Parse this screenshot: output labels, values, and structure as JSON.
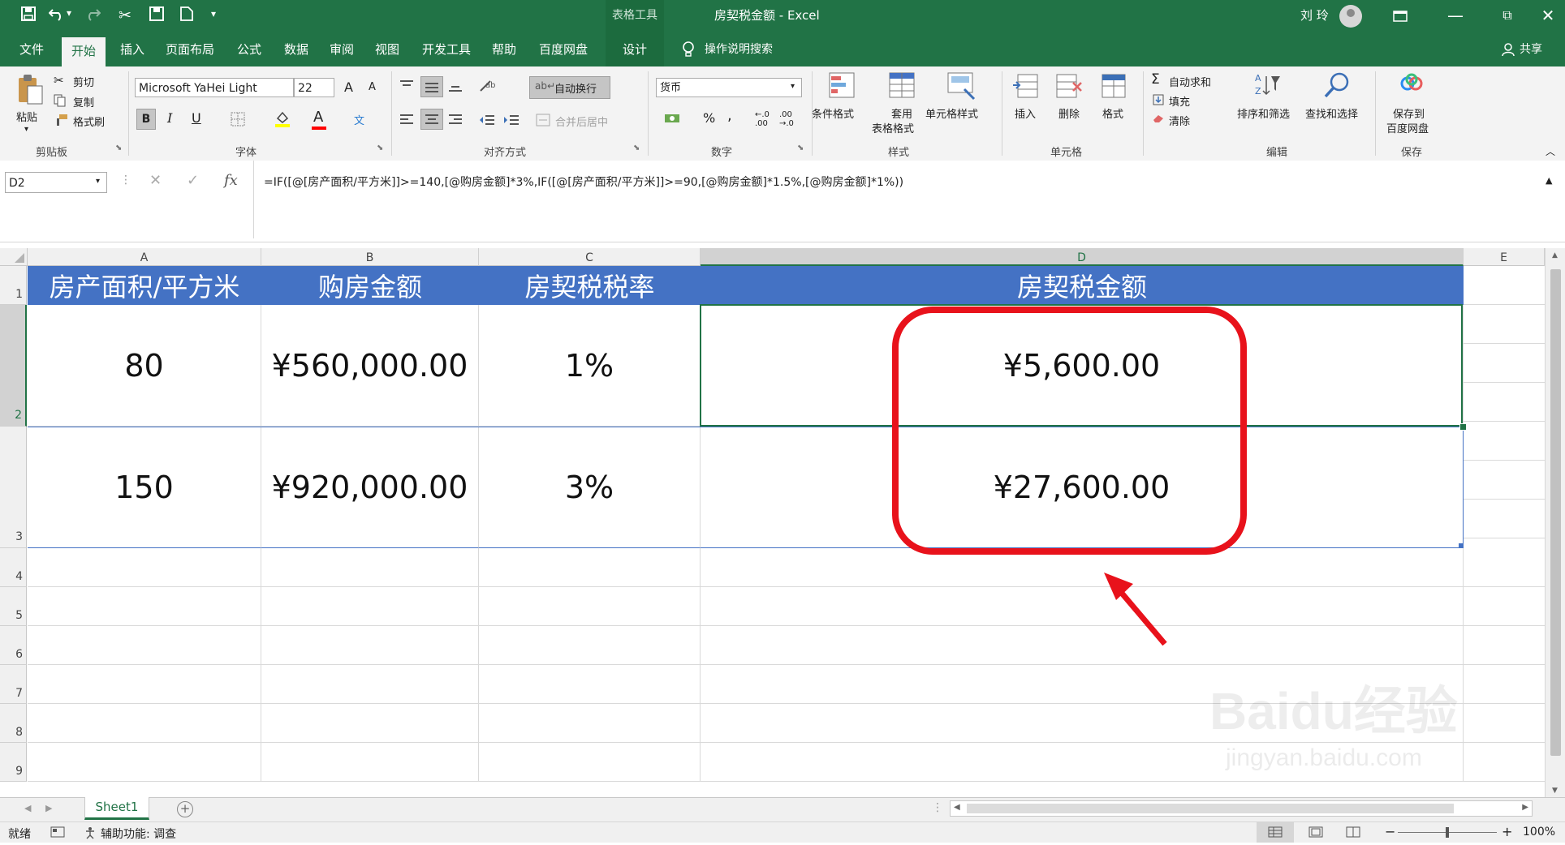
{
  "quick_access": {
    "save_icon": "save-icon",
    "undo_icon": "undo-icon",
    "redo_icon": "redo-icon",
    "more": "▾"
  },
  "titlebar": {
    "context_tab": "表格工具",
    "title": "房契税金额 - Excel",
    "user": "刘 玲",
    "restore": "⧉"
  },
  "tabs": [
    "文件",
    "开始",
    "插入",
    "页面布局",
    "公式",
    "数据",
    "审阅",
    "视图",
    "开发工具",
    "帮助",
    "百度网盘",
    "设计"
  ],
  "tell_me": "操作说明搜索",
  "share": "共享",
  "ribbon": {
    "clipboard": {
      "paste": "粘贴",
      "cut": "剪切",
      "copy": "复制",
      "format_painter": "格式刷",
      "label": "剪贴板"
    },
    "font": {
      "name": "Microsoft YaHei Light",
      "size": "22",
      "bold": "B",
      "italic": "I",
      "underline": "U",
      "label": "字体",
      "grow": "A",
      "shrink": "A",
      "font_color": "A",
      "phonetic": "文"
    },
    "alignment": {
      "wrap": "自动换行",
      "merge": "合并后居中",
      "label": "对齐方式"
    },
    "number": {
      "format": "货币",
      "percent": "%",
      "comma": ",",
      "label": "数字"
    },
    "styles": {
      "conditional": "条件格式",
      "table_line1": "套用",
      "table_line2": "表格格式",
      "cell_styles": "单元格样式",
      "label": "样式"
    },
    "cells": {
      "insert": "插入",
      "delete": "删除",
      "format": "格式",
      "label": "单元格"
    },
    "editing": {
      "autosum": "自动求和",
      "fill": "填充",
      "clear": "清除",
      "sort": "排序和筛选",
      "find": "查找和选择",
      "label": "编辑"
    },
    "save": {
      "line1": "保存到",
      "line2": "百度网盘",
      "label": "保存"
    }
  },
  "formula_bar": {
    "name_box": "D2",
    "fx": "fx",
    "formula": "=IF([@[房产面积/平方米]]>=140,[@购房金额]*3%,IF([@[房产面积/平方米]]>=90,[@购房金额]*1.5%,[@购房金额]*1%))"
  },
  "columns": [
    "A",
    "B",
    "C",
    "D",
    "E"
  ],
  "rows": [
    "1",
    "2",
    "3",
    "4",
    "5",
    "6",
    "7",
    "8",
    "9"
  ],
  "table": {
    "headers": [
      "房产面积/平方米",
      "购房金额",
      "房契税税率",
      "房契税金额"
    ],
    "rows": [
      [
        "80",
        "¥560,000.00",
        "1%",
        "¥5,600.00"
      ],
      [
        "150",
        "¥920,000.00",
        "3%",
        "¥27,600.00"
      ]
    ]
  },
  "annotation": {
    "color": "#e8121b"
  },
  "sheet_tabs": [
    "Sheet1"
  ],
  "status": {
    "ready": "就绪",
    "accessibility": "辅助功能: 调查",
    "zoom": "100%"
  },
  "watermark": {
    "brand": "Baidu经验",
    "url": "jingyan.baidu.com"
  },
  "colors": {
    "excel_green": "#217346",
    "header_blue": "#4472c4"
  }
}
